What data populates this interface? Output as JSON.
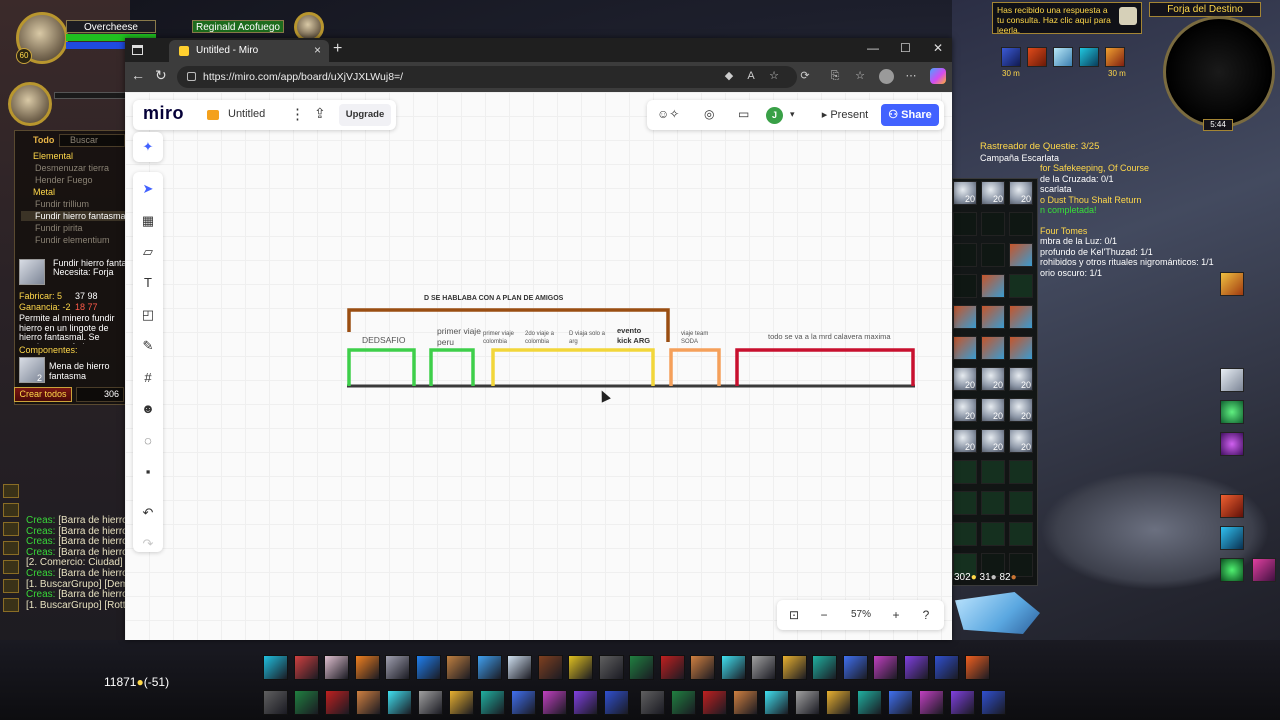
{
  "game": {
    "player_name": "Overcheese",
    "target_name": "Reginald Acofuego",
    "profession_panel": {
      "all_label": "Todo",
      "search_placeholder": "Buscar",
      "categories": [
        {
          "label": "Elemental",
          "items": [
            "Desmenuzar tierra",
            "Hender Fuego"
          ]
        },
        {
          "label": "Metal",
          "items": [
            "Fundir trillium",
            "Fundir hierro fantasmal",
            "Fundir pirita",
            "Fundir elementium"
          ]
        }
      ],
      "selected_item": "Fundir hierro fantasmal",
      "recipe_title": "Fundir hierro fantasmal",
      "requires_label": "Necesita: Forja",
      "cost_label": "Fabricar: 5",
      "cost_value": "37  98",
      "profit_label": "Ganancia: -2",
      "profit_value": "18  77",
      "description": "Permite al minero fundir hierro en un lingote de hierro fantasmal. Se requiere una forja.",
      "components_label": "Componentes:",
      "component_name": "Mena de hierro fantasma",
      "component_count": "2",
      "craft_all_label": "Crear todos",
      "craft_count": "306"
    },
    "chat_lines": [
      {
        "prefix": "Creas:",
        "text": " [Barra de hierro"
      },
      {
        "prefix": "Creas:",
        "text": " [Barra de hierro"
      },
      {
        "prefix": "Creas:",
        "text": " [Barra de hierro"
      },
      {
        "prefix": "Creas:",
        "text": " [Barra de hierro"
      },
      {
        "prefix": "",
        "text": "[2. Comercio: Ciudad] ["
      },
      {
        "prefix": "Creas:",
        "text": " [Barra de hierro"
      },
      {
        "prefix": "",
        "text": "[1. BuscarGrupo] [Dem"
      },
      {
        "prefix": "Creas:",
        "text": " [Barra de hierro"
      },
      {
        "prefix": "",
        "text": "[1. BuscarGrupo] [Rotti"
      }
    ],
    "gold": "11871",
    "gold_delta": "(-51)",
    "notification": "Has recibido una respuesta a tu consulta. Haz clic aquí para leerla.",
    "zone": "Forja del Destino",
    "clock": "5:44",
    "buff_timers": [
      "30 m",
      "30 m"
    ],
    "quest_tracker": {
      "header": "Rastreador de Questie: 3/25",
      "lines": [
        {
          "type": "o",
          "text": "Campaña Escarlata"
        },
        {
          "type": "q",
          "text": "for Safekeeping, Of Course"
        },
        {
          "type": "o",
          "text": "de la Cruzada: 0/1"
        },
        {
          "type": "o",
          "text": "scarlata"
        },
        {
          "type": "q",
          "text": "o Dust Thou Shalt Return"
        },
        {
          "type": "c",
          "text": "n completada!"
        },
        {
          "type": "q",
          "text": "Four Tomes"
        },
        {
          "type": "o",
          "text": "mbra de la Luz: 0/1"
        },
        {
          "type": "o",
          "text": "profundo de Kel'Thuzad: 1/1"
        },
        {
          "type": "o",
          "text": "rohibidos y otros rituales nigrománticos: 1/1"
        },
        {
          "type": "o",
          "text": "orio oscuro: 1/1"
        }
      ]
    },
    "bag_money": {
      "gold": "302",
      "silver": "31",
      "copper": "82"
    },
    "stack_counts": [
      "20",
      "20",
      "20"
    ]
  },
  "browser": {
    "tab_title": "Untitled - Miro",
    "url": "https://miro.com/app/board/uXjVJXLWuj8=/"
  },
  "miro": {
    "logo": "miro",
    "board_title": "Untitled",
    "upgrade_label": "Upgrade",
    "avatar_initial": "J",
    "present_label": "Present",
    "share_label": "Share",
    "zoom": "57%",
    "diagram": {
      "top_label": "D SE HABLABA  CON A PLAN DE AMIGOS",
      "segments": [
        {
          "label": "DEDSAFIO",
          "color": "#3ecf4a"
        },
        {
          "label": "primer viaje peru",
          "color": "#3ecf4a"
        },
        {
          "label": "primer viaje colombia",
          "color": "#f2d63a"
        },
        {
          "label": "2do viaje a colombia",
          "color": "#f2d63a"
        },
        {
          "label": "D viaja solo a arg",
          "color": "#f2d63a"
        },
        {
          "label": "evento kick ARG",
          "color": "#f2d63a"
        },
        {
          "label": "viaje team SODA",
          "color": "#f5a05a"
        },
        {
          "label": "todo se va a la mrd calavera maxima",
          "color": "#c8102e"
        }
      ],
      "bracket_color": "#9a4e12"
    }
  }
}
